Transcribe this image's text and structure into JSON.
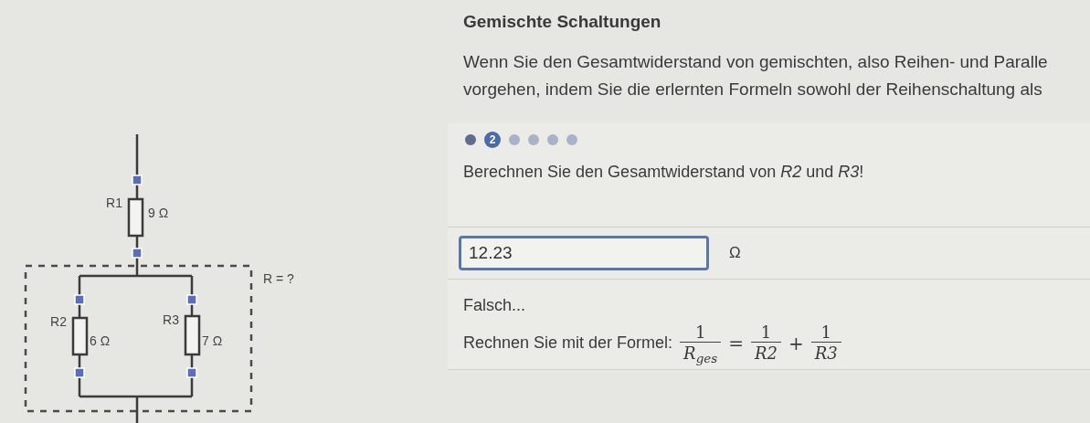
{
  "title": "Gemischte Schaltungen",
  "intro_lines": [
    "Wenn Sie den Gesamtwiderstand von gemischten, also Reihen- und Paralle",
    "vorgehen, indem Sie die erlernten Formeln sowohl der Reihenschaltung als"
  ],
  "circuit": {
    "resistors": [
      {
        "label": "R1",
        "value": "9 Ω"
      },
      {
        "label": "R2",
        "value": "6 Ω"
      },
      {
        "label": "R3",
        "value": "7 Ω"
      }
    ],
    "group_label": "R = ?"
  },
  "steps": [
    {
      "selected": false,
      "done": true
    },
    {
      "selected": true,
      "done": false,
      "label": "2"
    },
    {
      "selected": false,
      "done": false
    },
    {
      "selected": false,
      "done": false
    },
    {
      "selected": false,
      "done": false
    },
    {
      "selected": false,
      "done": false
    }
  ],
  "question": "Berechnen Sie den Gesamtwiderstand von *R2* und *R3*!",
  "answer": {
    "value": "12.23",
    "unit": "Ω"
  },
  "feedback": "Falsch...",
  "hint": {
    "text": "Rechnen Sie mit der Formel:",
    "formula": [
      {
        "kind": "fraction",
        "numerator": "1",
        "denominator": "R$_{ges}$"
      },
      {
        "kind": "operator",
        "text": "="
      },
      {
        "kind": "fraction",
        "numerator": "1",
        "denominator": "R2"
      },
      {
        "kind": "operator",
        "text": "+"
      },
      {
        "kind": "fraction",
        "numerator": "1",
        "denominator": "R3"
      }
    ]
  }
}
